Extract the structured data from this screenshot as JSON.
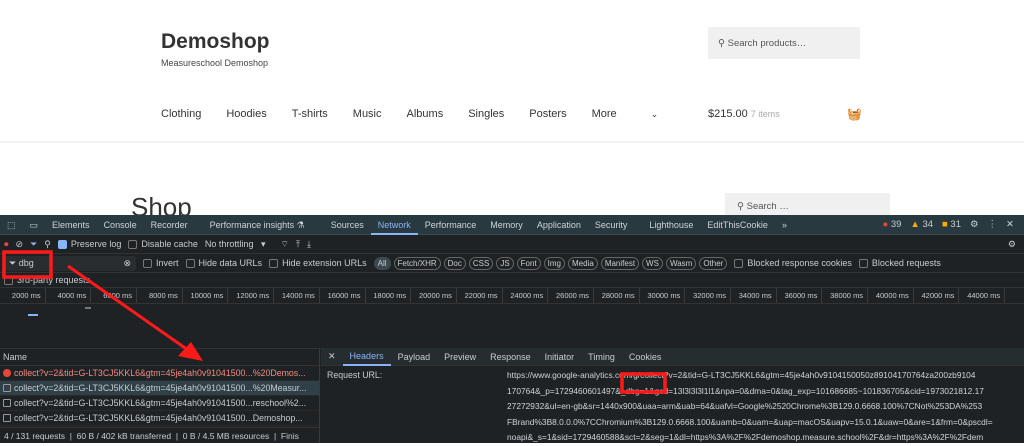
{
  "site": {
    "title": "Demoshop",
    "tagline": "Measureschool Demoshop",
    "search_placeholder": "Search products…",
    "nav": [
      "Clothing",
      "Hoodies",
      "T-shirts",
      "Music",
      "Albums",
      "Singles",
      "Posters",
      "More"
    ],
    "cart_total": "$215.00",
    "cart_items": "7 items",
    "page_heading": "Shop",
    "sidebar_search_placeholder": "Search …"
  },
  "devtools": {
    "tabs": [
      "Elements",
      "Console",
      "Recorder",
      "Performance insights ⚗",
      "Sources",
      "Network",
      "Performance",
      "Memory",
      "Application",
      "Security",
      "Lighthouse",
      "EditThisCookie",
      "»"
    ],
    "active_tab": "Network",
    "errors": "39",
    "warnings": "34",
    "issues": "31",
    "toolbar": {
      "preserve_log": "Preserve log",
      "disable_cache": "Disable cache",
      "throttling": "No throttling"
    },
    "filter": {
      "value": "dbg",
      "invert": "Invert",
      "hide_data": "Hide data URLs",
      "hide_ext": "Hide extension URLs",
      "types": [
        "All",
        "Fetch/XHR",
        "Doc",
        "CSS",
        "JS",
        "Font",
        "Img",
        "Media",
        "Manifest",
        "WS",
        "Wasm",
        "Other"
      ],
      "blocked_cookies": "Blocked response cookies",
      "blocked_requests": "Blocked requests",
      "third_party": "3rd-party requests"
    },
    "timeline_ticks": [
      "2000 ms",
      "4000 ms",
      "6000 ms",
      "8000 ms",
      "10000 ms",
      "12000 ms",
      "14000 ms",
      "16000 ms",
      "18000 ms",
      "20000 ms",
      "22000 ms",
      "24000 ms",
      "26000 ms",
      "28000 ms",
      "30000 ms",
      "32000 ms",
      "34000 ms",
      "36000 ms",
      "38000 ms",
      "40000 ms",
      "42000 ms",
      "44000 ms"
    ],
    "name_header": "Name",
    "requests": [
      {
        "name": "collect?v=2&tid=G-LT3CJ5KKL6&gtm=45je4ah0v91041500...%20Demos...",
        "status": "error"
      },
      {
        "name": "collect?v=2&tid=G-LT3CJ5KKL6&gtm=45je4ah0v91041500...%20Measur...",
        "status": "selected"
      },
      {
        "name": "collect?v=2&tid=G-LT3CJ5KKL6&gtm=45je4ah0v91041500...reschool%2...",
        "status": "ok"
      },
      {
        "name": "collect?v=2&tid=G-LT3CJ5KKL6&gtm=45je4ah0v91041500...Demoshop...",
        "status": "ok"
      }
    ],
    "status_bar": {
      "requests": "4 / 131 requests",
      "transferred": "60 B / 402 kB transferred",
      "resources": "0 B / 4.5 MB resources",
      "finish": "Finis"
    },
    "detail_tabs": [
      "Headers",
      "Payload",
      "Preview",
      "Response",
      "Initiator",
      "Timing",
      "Cookies"
    ],
    "request_url_label": "Request URL:",
    "request_url_lines": [
      "https://www.google-analytics.com/g/collect?v=2&tid=G-LT3CJ5KKL6&gtm=45je4ah0v9104150050z89104170764za200zb9104",
      "170764&_p=1729460601497&_dbg=1&gcd=13l3l3l3l1l1&npa=0&dma=0&tag_exp=101686685~101836705&cid=1973021812.17",
      "27272932&ul=en-gb&sr=1440x900&uaa=arm&uab=64&uafvl=Google%2520Chrome%3B129.0.6668.100%7CNot%253DA%253",
      "FBrand%3B8.0.0.0%7CChromium%3B129.0.6668.100&uamb=0&uam=&uap=macOS&uapv=15.0.1&uaw=0&are=1&frm=0&pscdl=",
      "noapi&_s=1&sid=1729460588&sct=2&seg=1&dl=https%3A%2F%2Fdemoshop.measure.school%2F&dr=https%3A%2F%2Fdem"
    ]
  },
  "annotation_color": "#ff1a1a"
}
